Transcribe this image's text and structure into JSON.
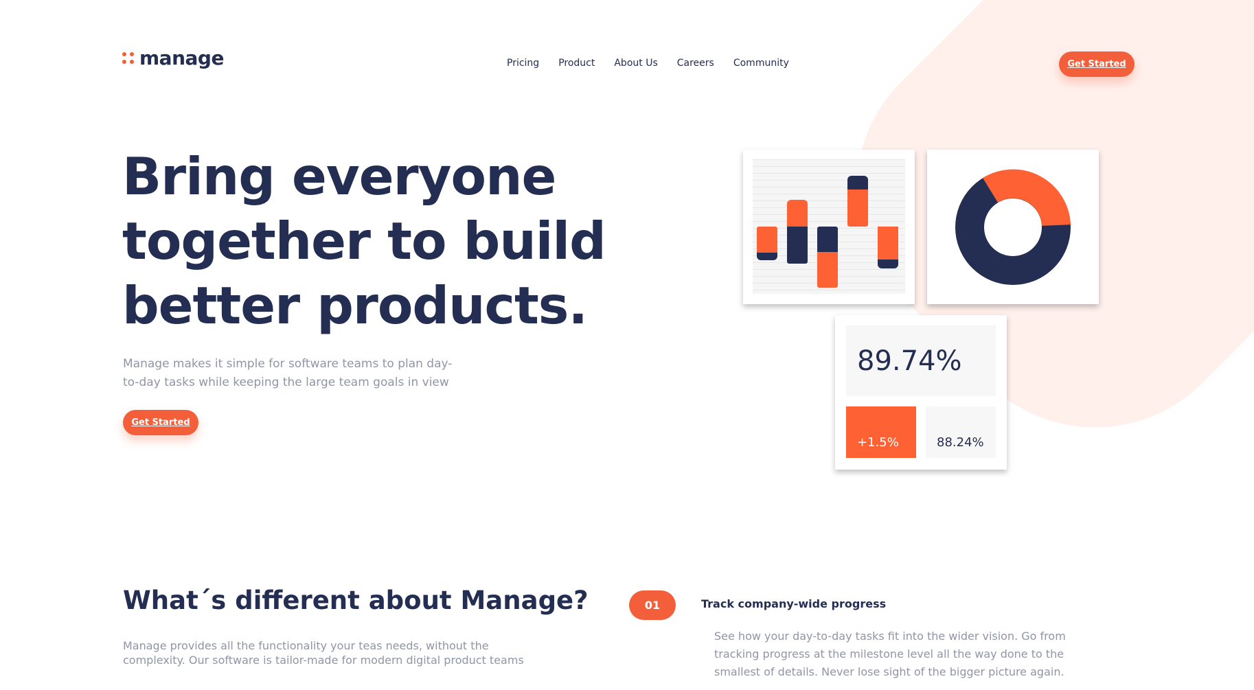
{
  "brand": {
    "name": "manage",
    "accent": "#f25f3a",
    "navy": "#242d52",
    "logo_icon": "four-dots-icon"
  },
  "nav": {
    "items": [
      "Pricing",
      "Product",
      "About Us",
      "Careers",
      "Community"
    ]
  },
  "header": {
    "cta_label": "Get Started"
  },
  "hero": {
    "title": "Bring everyone together to build better products.",
    "description": "Manage makes it simple for software teams to plan day-to-day tasks while keeping the large team goals in view",
    "cta_label": "Get Started"
  },
  "dashboard": {
    "stat_main": "89.74%",
    "stat_change": "+1.5%",
    "stat_secondary": "88.24%"
  },
  "features": {
    "title": "What´s different about Manage?",
    "description": "Manage provides all the functionality your teas needs, without the complexity. Our software is tailor-made for modern digital product teams",
    "items": [
      {
        "number": "01",
        "title": "Track company-wide progress",
        "description": "See how your day-to-day tasks fit into the wider vision. Go from tracking progress at the milestone level all the way done to the smallest of details. Never lose sight of the bigger picture again."
      }
    ]
  }
}
